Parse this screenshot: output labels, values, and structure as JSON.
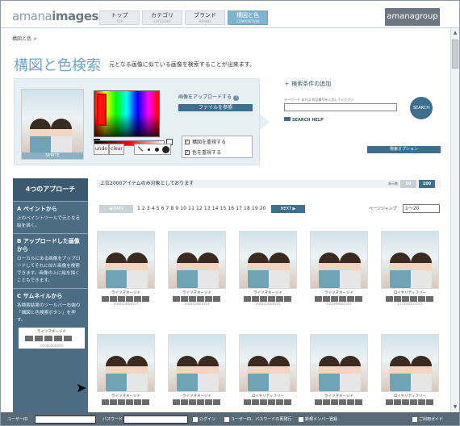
{
  "header": {
    "logo_main": "amana",
    "logo_sub": "images",
    "group_label": "amanagroup",
    "nav": [
      {
        "label": "トップ",
        "sub": "TOP"
      },
      {
        "label": "カテゴリ",
        "sub": "CATEGORY"
      },
      {
        "label": "ブランド",
        "sub": "BRAND"
      },
      {
        "label": "構図と色",
        "sub": "COMPOSITION"
      }
    ]
  },
  "breadcrumb": "構図と色 >",
  "page": {
    "title": "構図と色検索",
    "subtitle": "元となる画像に似ている画像を検索することが出来ます。"
  },
  "search_panel": {
    "preview_caption": "SPRITE",
    "tools": [
      "undo",
      "clear"
    ],
    "upload_label": "画像をアップロードする",
    "browse_button": "ファイルを参照",
    "check_composition": "構図を重視する",
    "check_color": "色を重視する",
    "add_condition": "検索条件の追加",
    "keyword_label": "キーワード または 作品番号を入力してください",
    "search_button": "SEARCH",
    "search_help": "SEARCH HELP",
    "options_button": "検索オプション"
  },
  "approach": {
    "title": "4つのアプローチ",
    "steps": [
      {
        "title": "A ペイントから",
        "text": "上のペイントツールで元となる絵を描く。"
      },
      {
        "title": "B アップロードした画像から",
        "text": "ローカルにある画像をアップロードしてそれに似た画像を検索できます。画像の上に絵を描くこともできます。"
      },
      {
        "title": "C サムネイルから",
        "text": "各検索結果のツールバー右端の「構図と色検索ボタン」を押す。"
      }
    ],
    "mini_label": "ライツマネージド",
    "mini_id": "00000000000"
  },
  "results": {
    "info": "上位2000アイテムのみ対象としております",
    "display_label": "表示数",
    "display_options": [
      "50",
      "100"
    ],
    "prev": "PREV",
    "pages": "1 2 3 4 5 6 7 8 9 10 11 12 13 14 15 16 17 18 19 20",
    "next": "NEXT",
    "jump_label": "ページジャンプ",
    "jump_value": "1〜20",
    "items": [
      {
        "license": "ライツマネージド",
        "id": "20001000637"
      },
      {
        "license": "ライツマネージド",
        "id": "20001000614"
      },
      {
        "license": "ライツマネージド",
        "id": "20001000635"
      },
      {
        "license": "ライツマネージド",
        "id": "02299000541"
      },
      {
        "license": "ロイヤリティフリー",
        "id": "11000010245"
      },
      {
        "license": "ライツマネージド",
        "id": ""
      },
      {
        "license": "ライツマネージド",
        "id": ""
      },
      {
        "license": "ロイヤリティフリー",
        "id": ""
      },
      {
        "license": "ライツマネージド",
        "id": ""
      },
      {
        "license": "ロイヤリティフリー",
        "id": ""
      }
    ]
  },
  "footer": {
    "user_label": "ユーザーID",
    "pass_label": "パスワード",
    "login": "ログイン",
    "resend": "ユーザーID、パスワードの再発行",
    "register": "新規メンバー登録",
    "guide": "ご利用ガイド"
  }
}
